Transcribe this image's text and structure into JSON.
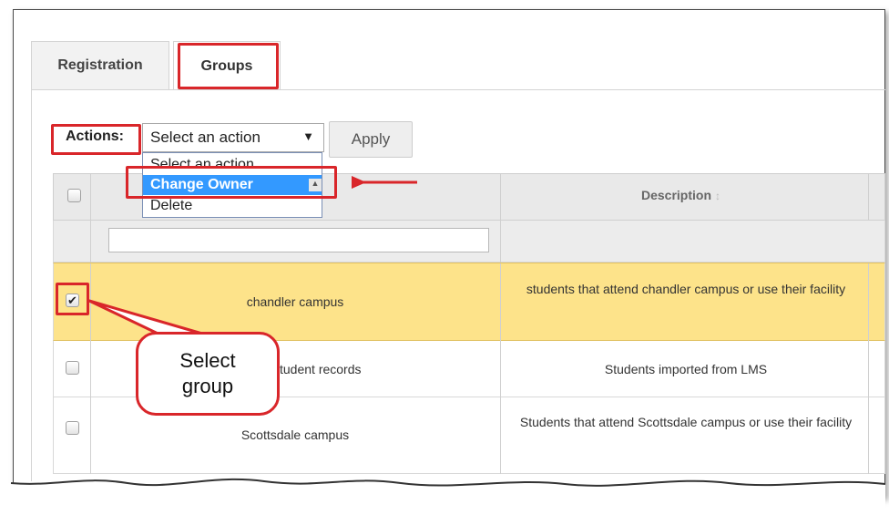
{
  "tabs": [
    {
      "label": "Registration"
    },
    {
      "label": "Groups"
    }
  ],
  "actions": {
    "label": "Actions:",
    "selected": "Select an action",
    "arrow": "▼",
    "apply_label": "Apply",
    "options": [
      "Select an action",
      "Change Owner",
      "Delete"
    ]
  },
  "table": {
    "columns": [
      {
        "label": "",
        "sort": ""
      },
      {
        "label": "Description",
        "sort": "↕"
      }
    ],
    "rows": [
      {
        "name": "chandler campus",
        "description": "students that attend chandler campus or use their facility",
        "checked": true
      },
      {
        "name": "tudent records",
        "description": "Students imported from LMS",
        "checked": false
      },
      {
        "name": "Scottsdale campus",
        "description": "Students that attend Scottsdale campus or use their facility",
        "checked": false
      }
    ]
  },
  "callout": {
    "text": "Select group"
  },
  "colors": {
    "highlight_row": "#fde38a",
    "annotation_red": "#d9262a",
    "selected_option": "#3399ff"
  }
}
